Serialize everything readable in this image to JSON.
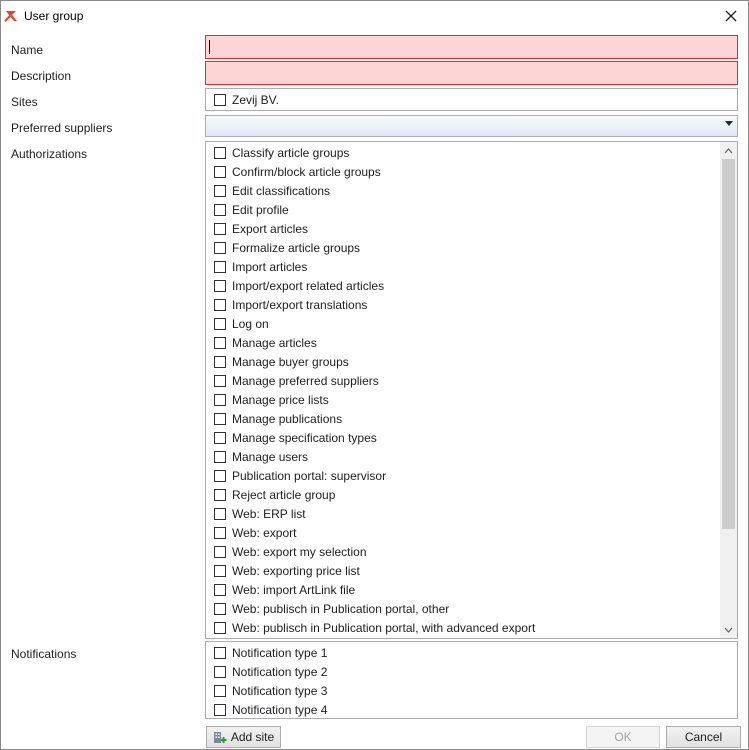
{
  "window": {
    "title": "User group"
  },
  "form": {
    "name_label": "Name",
    "name_value": "",
    "description_label": "Description",
    "description_value": "",
    "sites_label": "Sites",
    "sites": [
      {
        "label": "Zevij BV.",
        "checked": false
      }
    ],
    "preferred_suppliers_label": "Preferred suppliers",
    "preferred_suppliers_value": "",
    "authorizations_label": "Authorizations",
    "authorizations": [
      "Classify article groups",
      "Confirm/block article groups",
      "Edit classifications",
      "Edit profile",
      "Export articles",
      "Formalize article groups",
      "Import articles",
      "Import/export related articles",
      "Import/export translations",
      "Log on",
      "Manage articles",
      "Manage buyer groups",
      "Manage preferred suppliers",
      "Manage price lists",
      "Manage publications",
      "Manage specification types",
      "Manage users",
      "Publication portal: supervisor",
      "Reject article group",
      "Web: ERP list",
      "Web: export",
      "Web: export my selection",
      "Web: exporting price list",
      "Web: import ArtLink file",
      "Web: publisch in Publication portal, other",
      "Web: publisch in Publication portal, with advanced export"
    ],
    "notifications_label": "Notifications",
    "notifications": [
      "Notification type 1",
      "Notification type 2",
      "Notification type 3",
      "Notification type 4"
    ]
  },
  "buttons": {
    "add_site": "Add site",
    "ok": "OK",
    "cancel": "Cancel"
  },
  "icons": {
    "app": "app-logo-icon",
    "close": "close-icon",
    "add_site": "add-site-icon",
    "dropdown": "chevron-down-icon"
  },
  "colors": {
    "invalid_bg": "#fdd5d5",
    "invalid_border": "#d3303a",
    "app_icon": "#e0452b"
  }
}
